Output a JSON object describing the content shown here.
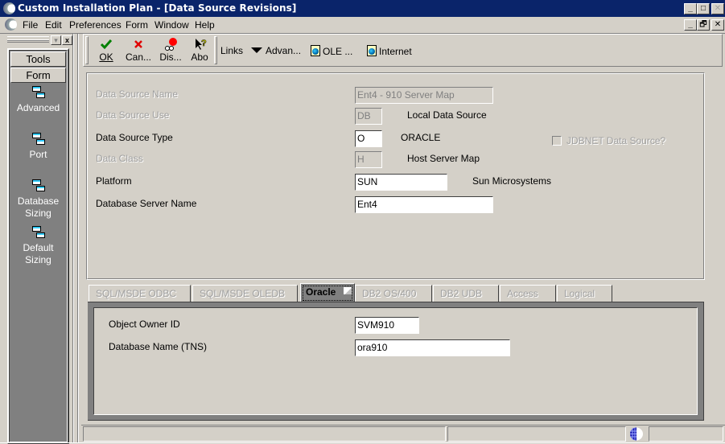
{
  "window": {
    "title": "Custom Installation Plan - [Data Source Revisions]",
    "caption_buttons": {
      "minimize": "_",
      "maximize": "□",
      "close": "✕"
    },
    "mdi_buttons": {
      "minimize": "_",
      "restore": "🗗",
      "close": "✕"
    }
  },
  "menu": {
    "items": [
      {
        "label": "File"
      },
      {
        "label": "Edit"
      },
      {
        "label": "Preferences"
      },
      {
        "label": "Form"
      },
      {
        "label": "Window"
      },
      {
        "label": "Help"
      }
    ]
  },
  "left_panel": {
    "pin_glyph": "▾",
    "close_glyph": "x",
    "tabs": [
      {
        "label": "Tools"
      },
      {
        "label": "Form"
      }
    ],
    "items": [
      {
        "label": "Advanced",
        "icon": "form-exit-icon"
      },
      {
        "label": "Port",
        "icon": "form-exit-icon"
      },
      {
        "label": "Database Sizing",
        "icon": "form-exit-icon"
      },
      {
        "label": "Default Sizing",
        "icon": "form-exit-icon"
      }
    ]
  },
  "toolbar": {
    "buttons": [
      {
        "label": "OK",
        "icon": "checkmark-icon",
        "color": "#008000"
      },
      {
        "label": "Can...",
        "icon": "cancel-x-icon",
        "color": "#e00000"
      },
      {
        "label": "Dis...",
        "icon": "display-glasses-icon",
        "color": "#ff0000"
      },
      {
        "label": "Abo",
        "icon": "about-help-icon",
        "color": "#ffff00"
      }
    ],
    "links_label": "Links",
    "links": [
      {
        "label": "Advan...",
        "icon": "dropdown-arrow-icon"
      },
      {
        "label": "OLE ...",
        "icon": "document-globe-icon"
      },
      {
        "label": "Internet",
        "icon": "document-globe-icon"
      }
    ]
  },
  "form": {
    "data_source_name": {
      "label": "Data Source Name",
      "value": "Ent4 - 910 Server Map",
      "enabled": false
    },
    "data_source_use": {
      "label": "Data Source Use",
      "value": "DB",
      "description": "Local Data Source",
      "enabled": false
    },
    "data_source_type": {
      "label": "Data Source Type",
      "value": "O",
      "description": "ORACLE",
      "enabled": true
    },
    "data_class": {
      "label": "Data Class",
      "value": "H",
      "description": "Host Server Map",
      "enabled": false
    },
    "platform": {
      "label": "Platform",
      "value": "SUN",
      "description": "Sun Microsystems",
      "enabled": true
    },
    "database_server_name": {
      "label": "Database Server Name",
      "value": "Ent4",
      "enabled": true
    },
    "jdbnet_checkbox": {
      "label": "JDBNET Data Source?",
      "checked": false,
      "enabled": false
    }
  },
  "tabs": {
    "items": [
      {
        "label": "SQL/MSDE ODBC",
        "active": false
      },
      {
        "label": "SQL/MSDE OLEDB",
        "active": false
      },
      {
        "label": "Oracle",
        "active": true
      },
      {
        "label": "DB2 OS/400",
        "active": false
      },
      {
        "label": "DB2 UDB",
        "active": false
      },
      {
        "label": "Access",
        "active": false
      },
      {
        "label": "Logical",
        "active": false
      }
    ]
  },
  "oracle_tab": {
    "object_owner_id": {
      "label": "Object Owner ID",
      "value": "SVM910"
    },
    "database_name": {
      "label": "Database Name (TNS)",
      "value": "ora910"
    }
  },
  "status_bar": {
    "cells": [
      "",
      "",
      ""
    ],
    "icon": "network-globe-icon"
  }
}
